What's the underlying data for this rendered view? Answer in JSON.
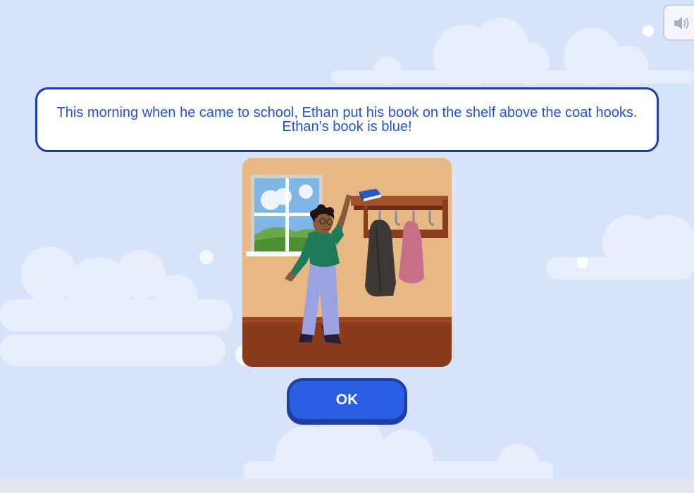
{
  "story": {
    "line1": "This morning when he came to school, Ethan put his book on the shelf above the coat hooks.",
    "line2": "Ethan’s book is blue!"
  },
  "buttons": {
    "ok_label": "OK"
  },
  "icons": {
    "sound": "speaker-volume-icon"
  },
  "colors": {
    "background": "#d6e3fb",
    "accent": "#2a5ee3",
    "accent_dark": "#1c3ea6",
    "story_text": "#2551d4"
  }
}
